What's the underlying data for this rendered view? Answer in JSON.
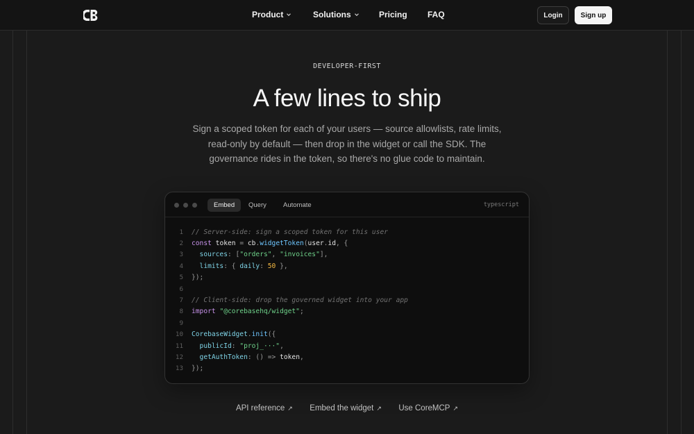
{
  "nav": {
    "logo_text": "CB",
    "product": "Product",
    "solutions": "Solutions",
    "pricing": "Pricing",
    "faq": "FAQ",
    "login": "Login",
    "signup": "Sign up"
  },
  "hero": {
    "eyebrow": "DEVELOPER-FIRST",
    "title": "A few lines to ship",
    "subtitle": "Sign a scoped token for each of your users — source allowlists, rate limits, read-only by default — then drop in the widget or call the SDK. The governance rides in the token, so there's no glue code to maintain."
  },
  "code_card": {
    "tabs": [
      "Embed",
      "Query",
      "Automate"
    ],
    "active_tab": "Embed",
    "language": "typescript",
    "line_numbers": [
      "1",
      "2",
      "3",
      "4",
      "5",
      "6",
      "7",
      "8",
      "9",
      "10",
      "11",
      "12",
      "13"
    ],
    "lines": [
      [
        {
          "t": "// Server-side: sign a scoped token for this user",
          "c": "com"
        }
      ],
      [
        {
          "t": "const",
          "c": "kw"
        },
        {
          "t": " token ",
          "c": "ct"
        },
        {
          "t": "=",
          "c": "pun"
        },
        {
          "t": " cb",
          "c": "ct"
        },
        {
          "t": ".",
          "c": "pun"
        },
        {
          "t": "widgetToken",
          "c": "fn"
        },
        {
          "t": "(",
          "c": "pun"
        },
        {
          "t": "user",
          "c": "ct"
        },
        {
          "t": ".",
          "c": "pun"
        },
        {
          "t": "id",
          "c": "ct"
        },
        {
          "t": ", {",
          "c": "pun"
        }
      ],
      [
        {
          "t": "  sources",
          "c": "prop"
        },
        {
          "t": ": [",
          "c": "pun"
        },
        {
          "t": "\"orders\"",
          "c": "str"
        },
        {
          "t": ", ",
          "c": "pun"
        },
        {
          "t": "\"invoices\"",
          "c": "str"
        },
        {
          "t": "],",
          "c": "pun"
        }
      ],
      [
        {
          "t": "  limits",
          "c": "prop"
        },
        {
          "t": ": { ",
          "c": "pun"
        },
        {
          "t": "daily",
          "c": "prop"
        },
        {
          "t": ": ",
          "c": "pun"
        },
        {
          "t": "50",
          "c": "num"
        },
        {
          "t": " },",
          "c": "pun"
        }
      ],
      [
        {
          "t": "});",
          "c": "pun"
        }
      ],
      [
        {
          "t": "",
          "c": "ct"
        }
      ],
      [
        {
          "t": "// Client-side: drop the governed widget into your app",
          "c": "com"
        }
      ],
      [
        {
          "t": "import",
          "c": "kw"
        },
        {
          "t": " ",
          "c": "ct"
        },
        {
          "t": "\"@corebasehq/widget\"",
          "c": "str"
        },
        {
          "t": ";",
          "c": "pun"
        }
      ],
      [
        {
          "t": "",
          "c": "ct"
        }
      ],
      [
        {
          "t": "CorebaseWidget",
          "c": "prop"
        },
        {
          "t": ".",
          "c": "pun"
        },
        {
          "t": "init",
          "c": "fn"
        },
        {
          "t": "({",
          "c": "pun"
        }
      ],
      [
        {
          "t": "  publicId",
          "c": "prop"
        },
        {
          "t": ": ",
          "c": "pun"
        },
        {
          "t": "\"proj_···\"",
          "c": "str"
        },
        {
          "t": ",",
          "c": "pun"
        }
      ],
      [
        {
          "t": "  getAuthToken",
          "c": "prop"
        },
        {
          "t": ": () ",
          "c": "pun"
        },
        {
          "t": "=>",
          "c": "pun"
        },
        {
          "t": " token",
          "c": "ct"
        },
        {
          "t": ",",
          "c": "pun"
        }
      ],
      [
        {
          "t": "});",
          "c": "pun"
        }
      ]
    ]
  },
  "links": [
    {
      "label": "API reference",
      "icon": "arrow-up-right-icon"
    },
    {
      "label": "Embed the widget",
      "icon": "arrow-up-right-icon"
    },
    {
      "label": "Use CoreMCP",
      "icon": "arrow-up-right-icon"
    }
  ],
  "colors": {
    "background": "#1b1b1b",
    "card": "#0e0e0e",
    "keyword": "#c792ea",
    "function": "#6ec6ff",
    "string": "#6fd28a",
    "number": "#f5b942"
  }
}
